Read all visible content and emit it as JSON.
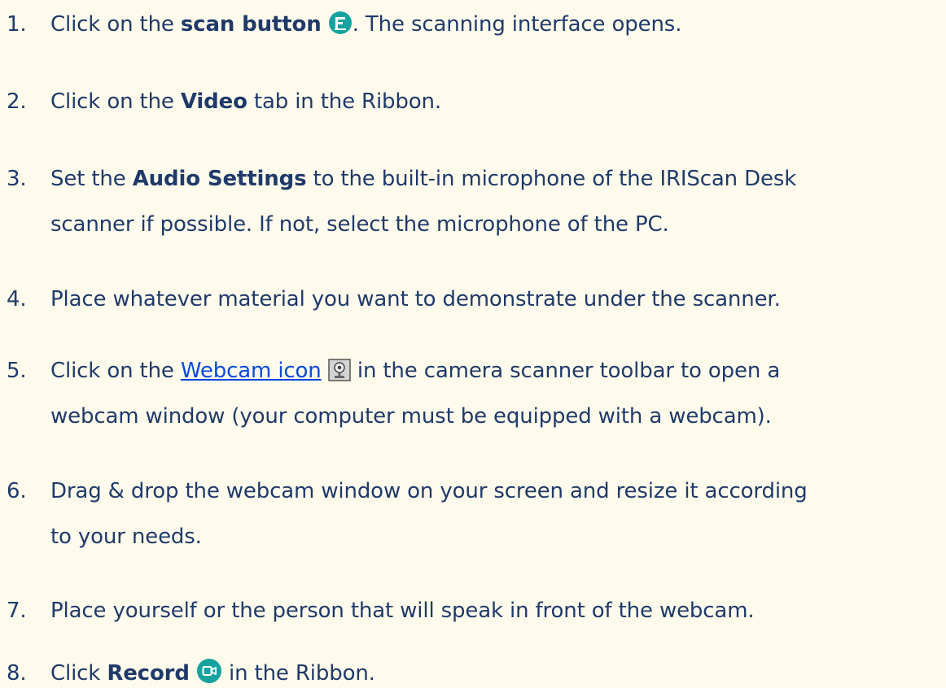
{
  "steps": [
    {
      "number": "1.",
      "before": "Click on the ",
      "bold": "scan button",
      "icon": "scan-button-icon",
      "after": ". The scanning interface opens."
    },
    {
      "number": "2.",
      "before": "Click on the ",
      "bold": "Video",
      "after": " tab in the Ribbon."
    },
    {
      "number": "3.",
      "before": "Set the ",
      "bold": "Audio Settings",
      "after": " to the built-in microphone of the IRIScan Desk",
      "line2": "scanner if possible. If not, select the microphone of the PC."
    },
    {
      "number": "4.",
      "text": "Place whatever material you want to demonstrate under the scanner."
    },
    {
      "number": "5.",
      "before": "Click on the ",
      "link": "Webcam icon",
      "icon": "webcam-icon",
      "after": " in the camera scanner toolbar to open a",
      "line2": "webcam window (your computer must be equipped with a webcam)."
    },
    {
      "number": "6.",
      "text": "Drag & drop the webcam window on your screen and resize it according",
      "line2": "to your needs."
    },
    {
      "number": "7.",
      "text": "Place yourself or the person that will speak in front of the webcam."
    },
    {
      "number": "8.",
      "before": "Click ",
      "bold": "Record",
      "icon": "record-icon",
      "after": " in the Ribbon."
    }
  ],
  "colors": {
    "background": "#fffbec",
    "text": "#1f3a6a",
    "link": "#0b49e0",
    "icon_teal": "#16a3a0"
  }
}
